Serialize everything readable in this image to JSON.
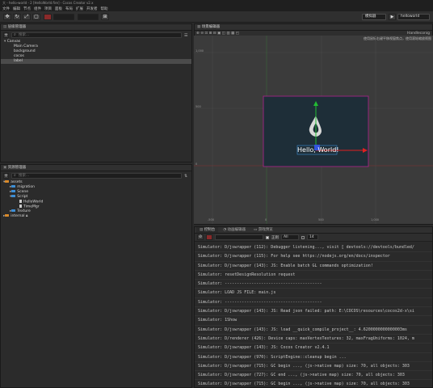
{
  "window": {
    "title": "大 - hello-world - 2 [HelloWorld.fire] - Cocos Creator v2.x"
  },
  "menu": [
    "文件",
    "编辑",
    "节点",
    "组件",
    "项目",
    "面板",
    "布局",
    "扩展",
    "开发者",
    "帮助"
  ],
  "toolbar": {
    "preview_target": "模拟器",
    "scene_select": "helloworld",
    "play_icon": "play-icon"
  },
  "hierarchy": {
    "title": "层级管理器",
    "search_placeholder": "搜索...",
    "root": "Canvas",
    "children": [
      "Main Camera",
      "background",
      "cocos",
      "label"
    ],
    "selected": "label"
  },
  "assets": {
    "title": "资源管理器",
    "search_placeholder": "搜索...",
    "items": [
      {
        "label": "assets",
        "level": 0,
        "type": "folder-orange"
      },
      {
        "label": "migration",
        "level": 1,
        "type": "folder"
      },
      {
        "label": "Scene",
        "level": 1,
        "type": "folder"
      },
      {
        "label": "Script",
        "level": 1,
        "type": "folder"
      },
      {
        "label": "HelloWorld",
        "level": 2,
        "type": "file"
      },
      {
        "label": "TimeMgr",
        "level": 2,
        "type": "file"
      },
      {
        "label": "Texture",
        "level": 1,
        "type": "folder"
      },
      {
        "label": "internal",
        "level": 0,
        "type": "folder-orange"
      }
    ]
  },
  "scene": {
    "title": "场景编辑器",
    "dropdown": "Handleconig",
    "hint": "使用鼠标右键平移视窗焦点，使用滚轮缩放视图",
    "y_ticks": [
      "1,000",
      "500",
      "0"
    ],
    "x_ticks": [
      "-500",
      "0",
      "500",
      "1,000"
    ],
    "canvas_label": "Hello, World!"
  },
  "console": {
    "tabs": [
      "控制台",
      "动画编辑器",
      "游戏预览"
    ],
    "filter_mode": "正则",
    "filter_level": "All",
    "font_size": "14",
    "lines": [
      "Simulator: D/jswrapper (112): Debugger listening..., visit [ devtools://devtools/bundled/",
      "Simulator: D/jswrapper (115): For help see https://nodejs.org/en/docs/inspector",
      "Simulator: D/jswrapper (143): JS: Enable batch GL commands optimization!",
      "Simulator: resetDesignResolution request",
      "Simulator: ----------------------------------------",
      "Simulator: LOAD JS FILE: main.js",
      "Simulator: ----------------------------------------",
      "Simulator: D/jswrapper (143): JS: Read json failed: path: E:\\COCOS\\resources\\cocos2d-x\\si",
      "Simulator: 1Show",
      "Simulator: D/jswrapper (143): JS: load __quick_compile_project__: 4.6200000000000003ms",
      "Simulator: D/renderer (426): Device caps: maxVertexTextures: 32, maxFragUniforms: 1024, m",
      "Simulator: D/jswrapper (143): JS: Cocos Creator v2.4.1",
      "Simulator: D/jswrapper (970): ScriptEngine::cleanup begin ...",
      "Simulator: D/jswrapper (715): GC begin ..., (js->native map) size: 70, all objects: 303",
      "Simulator: D/jswrapper (727): GC end ..., (js->native map) size: 70, all objects: 303",
      "Simulator: D/jswrapper (715): GC begin ..., (js->native map) size: 70, all objects: 303"
    ]
  },
  "colors": {
    "accent_blue": "#3d8fd6",
    "folder_orange": "#d98a2a",
    "axis_red": "#e02020",
    "axis_green": "#22bb33",
    "canvas_border": "#b0228f",
    "canvas_bg": "#1e2e38"
  }
}
